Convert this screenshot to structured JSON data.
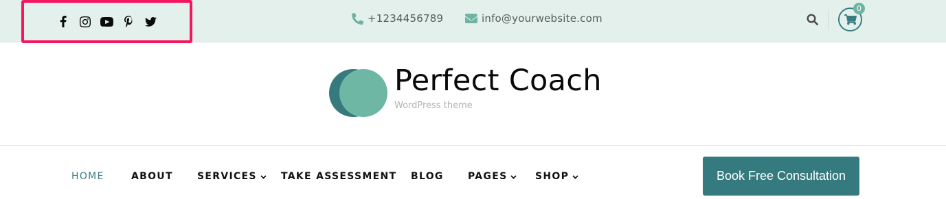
{
  "topbar": {
    "social": [
      {
        "icon": "facebook-icon"
      },
      {
        "icon": "instagram-icon"
      },
      {
        "icon": "youtube-icon"
      },
      {
        "icon": "pinterest-icon"
      },
      {
        "icon": "twitter-icon"
      }
    ],
    "phone": "+1234456789",
    "email": "info@yourwebsite.com",
    "cart_count": "0"
  },
  "brand": {
    "title": "Perfect Coach",
    "subtitle": "WordPress theme"
  },
  "nav": {
    "items": [
      {
        "label": "HOME",
        "active": true,
        "dropdown": false
      },
      {
        "label": "ABOUT",
        "active": false,
        "dropdown": false
      },
      {
        "label": "SERVICES",
        "active": false,
        "dropdown": true
      },
      {
        "label": "TAKE ASSESSMENT",
        "active": false,
        "dropdown": false
      },
      {
        "label": "BLOG",
        "active": false,
        "dropdown": false
      },
      {
        "label": "PAGES",
        "active": false,
        "dropdown": true
      },
      {
        "label": "SHOP",
        "active": false,
        "dropdown": true
      }
    ],
    "cta_label": "Book Free Consultation"
  },
  "colors": {
    "topbar_bg": "#e3f0eb",
    "accent": "#357a7e",
    "accent_light": "#6fb3a4",
    "highlight_border": "#f7155e"
  }
}
